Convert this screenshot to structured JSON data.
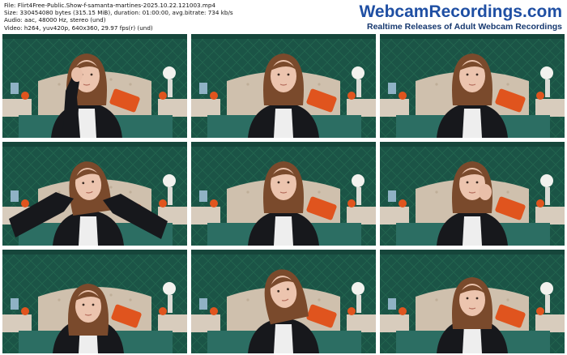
{
  "file_info": {
    "file": "File: Flirt4Free-Public.Show-f-samanta-martines-2025.10.22.121003.mp4",
    "size": "Size: 330454080 bytes (315.15 MiB), duration: 01:00:00, avg.bitrate: 734 kb/s",
    "audio": "Audio: aac, 48000 Hz, stereo (und)",
    "video": "Video: h264, yuv420p, 640x360, 29.97 fps(r) (und)"
  },
  "brand": {
    "name": "WebcamRecordings.com",
    "tagline": "Realtime Releases of Adult Webcam Recordings"
  },
  "colors": {
    "wall": "#1b5446",
    "headboard": "#cfc0ad",
    "pillow_orange": "#e0541e",
    "jacket": "#17181c",
    "hair": "#7a4a2c",
    "brand_blue": "#1f4fa3"
  },
  "thumbnails": [
    {
      "pose": "hands-raised"
    },
    {
      "pose": "front"
    },
    {
      "pose": "front"
    },
    {
      "pose": "arms-wide"
    },
    {
      "pose": "front"
    },
    {
      "pose": "hand-face"
    },
    {
      "pose": "looking-down"
    },
    {
      "pose": "head-tilt"
    },
    {
      "pose": "front-low"
    }
  ]
}
